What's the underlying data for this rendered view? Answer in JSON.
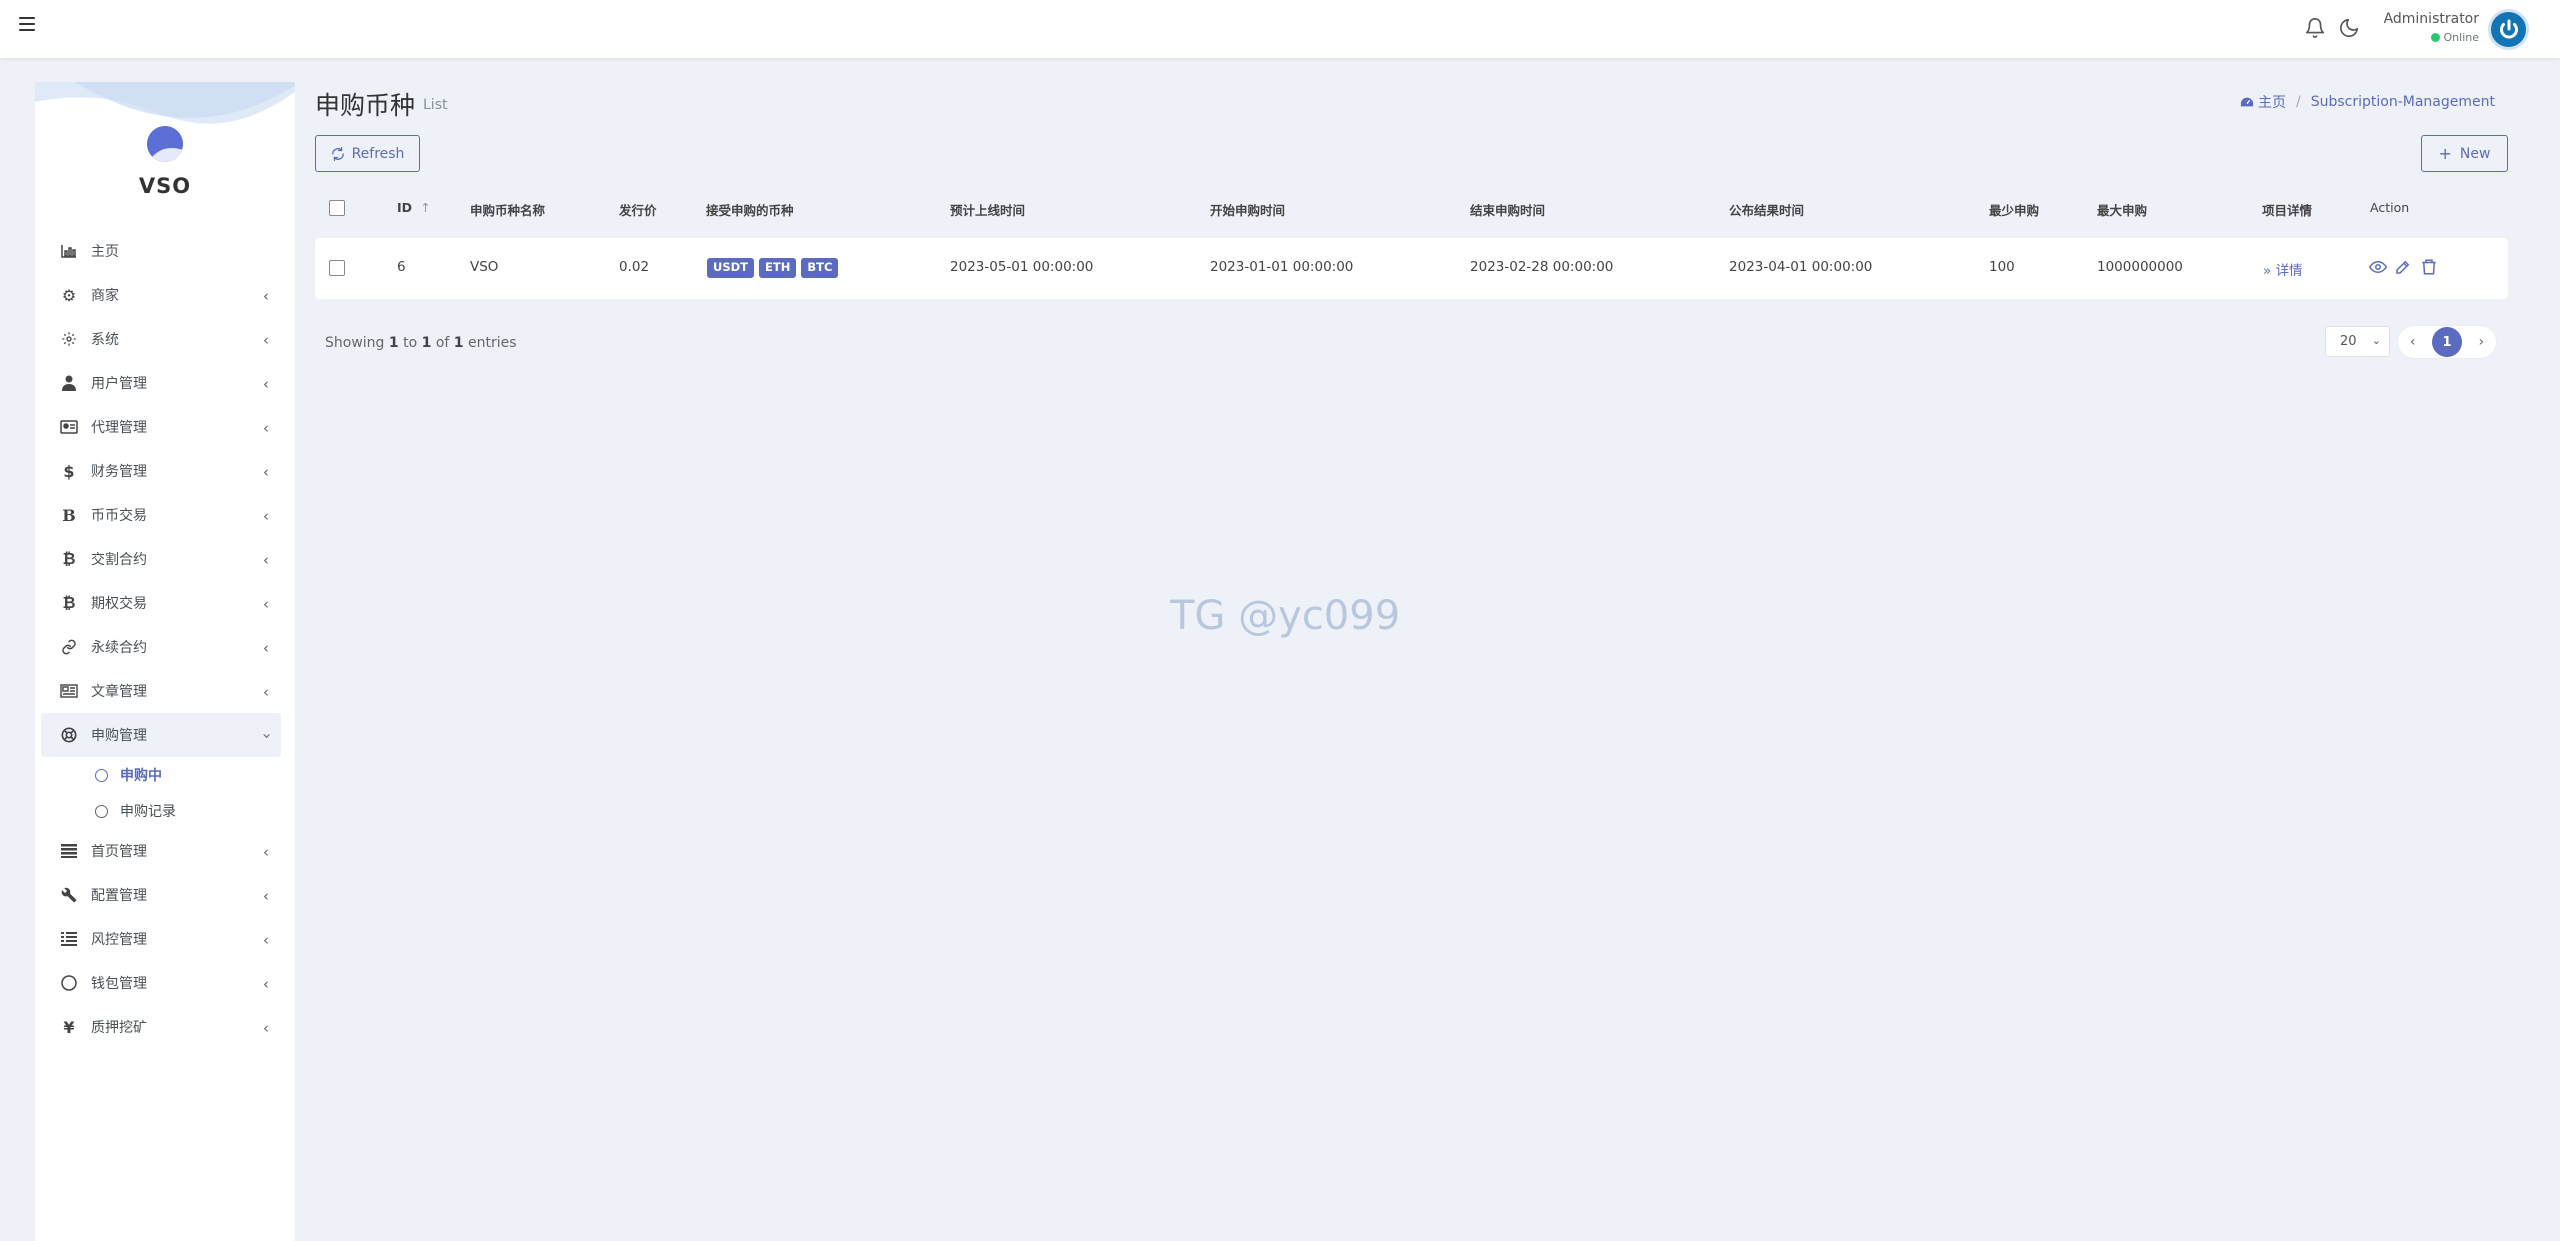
{
  "header": {
    "user_name": "Administrator",
    "user_status": "Online"
  },
  "sidebar": {
    "logo_text": "VSO",
    "items": [
      {
        "label": "主页",
        "icon": "bar-chart-icon",
        "has_chevron": false
      },
      {
        "label": "商家",
        "icon": "gears-icon",
        "has_chevron": true
      },
      {
        "label": "系统",
        "icon": "gear-icon",
        "has_chevron": true
      },
      {
        "label": "用户管理",
        "icon": "user-icon",
        "has_chevron": true
      },
      {
        "label": "代理管理",
        "icon": "id-card-icon",
        "has_chevron": true
      },
      {
        "label": "财务管理",
        "icon": "dollar-icon",
        "has_chevron": true
      },
      {
        "label": "币币交易",
        "icon": "b-letter-icon",
        "has_chevron": true
      },
      {
        "label": "交割合约",
        "icon": "bitcoin-icon",
        "has_chevron": true
      },
      {
        "label": "期权交易",
        "icon": "bitcoin-icon",
        "has_chevron": true
      },
      {
        "label": "永续合约",
        "icon": "link-icon",
        "has_chevron": true
      },
      {
        "label": "文章管理",
        "icon": "newspaper-icon",
        "has_chevron": true
      },
      {
        "label": "申购管理",
        "icon": "lifebuoy-icon",
        "has_chevron": true
      },
      {
        "label": "首页管理",
        "icon": "list-icon",
        "has_chevron": true
      },
      {
        "label": "配置管理",
        "icon": "wrench-icon",
        "has_chevron": true
      },
      {
        "label": "风控管理",
        "icon": "list-alt-icon",
        "has_chevron": true
      },
      {
        "label": "钱包管理",
        "icon": "circle-icon",
        "has_chevron": true
      },
      {
        "label": "质押挖矿",
        "icon": "yen-icon",
        "has_chevron": true
      }
    ],
    "subitems": [
      {
        "label": "申购中"
      },
      {
        "label": "申购记录"
      }
    ]
  },
  "page": {
    "title": "申购币种",
    "subtitle": "List",
    "breadcrumb_home": "主页",
    "breadcrumb_current": "Subscription-Management",
    "refresh_label": "Refresh",
    "new_label": "New"
  },
  "table": {
    "columns": [
      "ID",
      "申购币种名称",
      "发行价",
      "接受申购的币种",
      "预计上线时间",
      "开始申购时间",
      "结束申购时间",
      "公布结果时间",
      "最少申购",
      "最大申购",
      "项目详情",
      "Action"
    ],
    "rows": [
      {
        "id": "6",
        "name": "VSO",
        "price": "0.02",
        "coins": [
          "USDT",
          "ETH",
          "BTC"
        ],
        "launch_time": "2023-05-01 00:00:00",
        "start_time": "2023-01-01 00:00:00",
        "end_time": "2023-02-28 00:00:00",
        "result_time": "2023-04-01 00:00:00",
        "min": "100",
        "max": "1000000000",
        "detail": "详情"
      }
    ]
  },
  "footer": {
    "showing_prefix": "Showing",
    "from": "1",
    "to_word": "to",
    "to": "1",
    "of_word": "of",
    "total": "1",
    "entries_word": "entries",
    "page_size": "20",
    "current_page": "1"
  },
  "watermark": "TG @yc099",
  "colors": {
    "accent": "#5b6bbf",
    "background": "#eef1f7",
    "online": "#28c76f"
  }
}
